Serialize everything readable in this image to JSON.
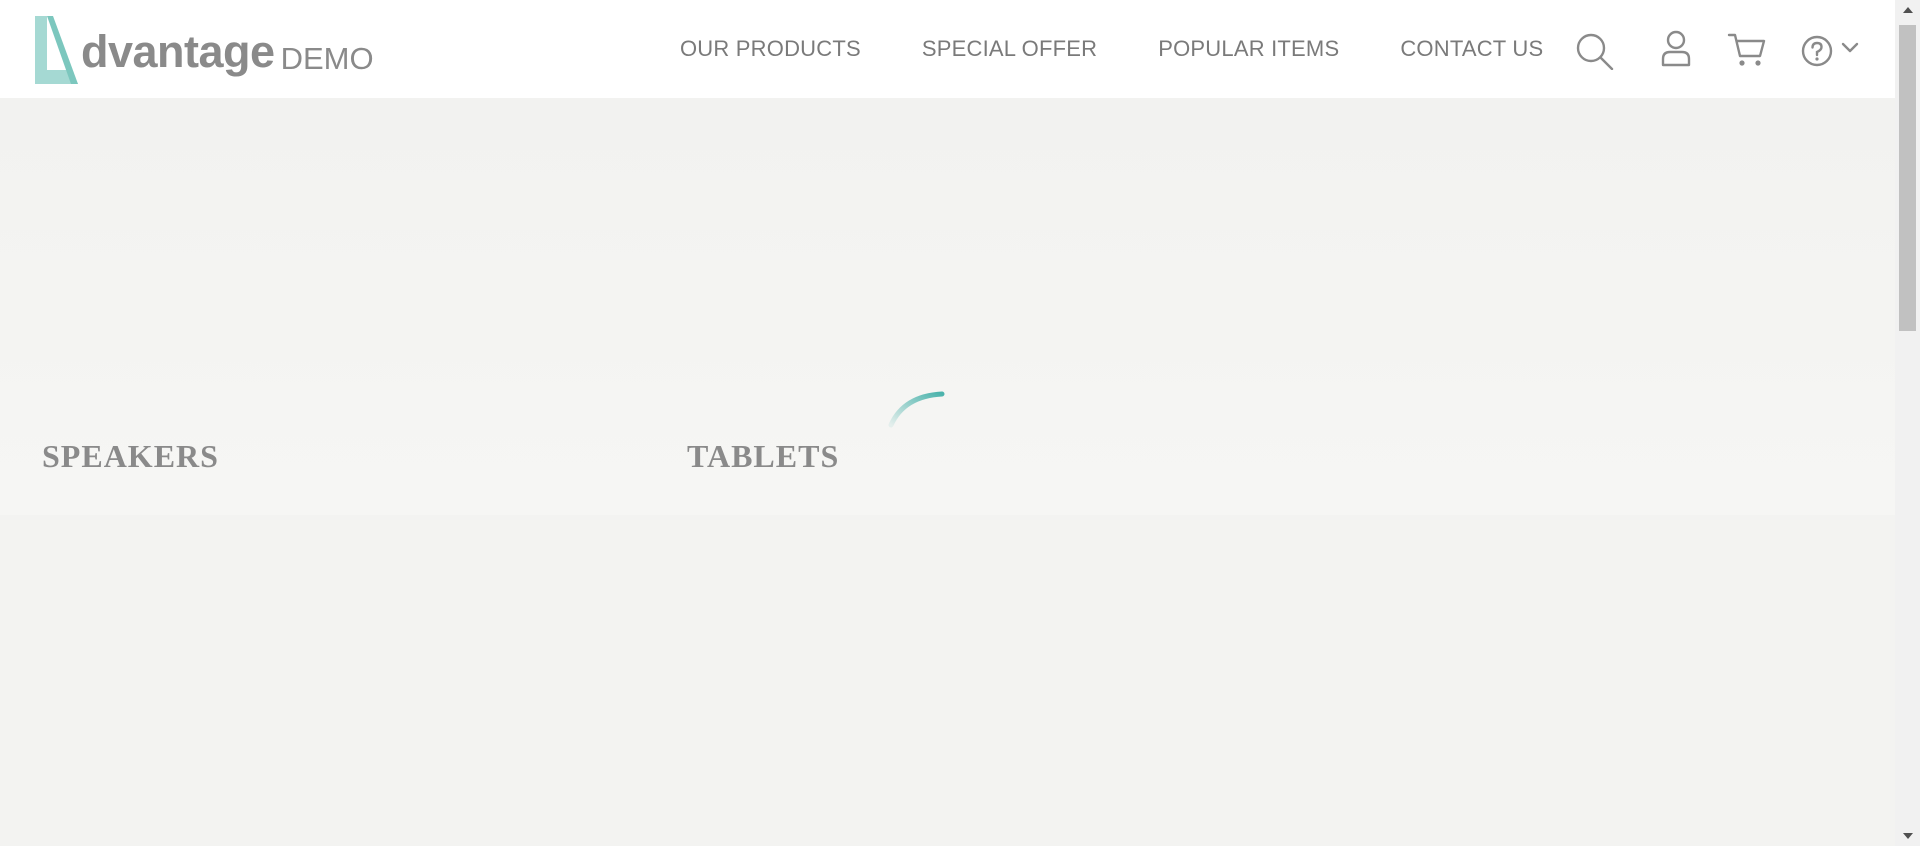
{
  "brand": {
    "name": "dvantage",
    "suffix": "DEMO",
    "accent": "#a5d9d3"
  },
  "nav": {
    "items": [
      {
        "label": "OUR PRODUCTS"
      },
      {
        "label": "SPECIAL OFFER"
      },
      {
        "label": "POPULAR ITEMS"
      },
      {
        "label": "CONTACT US"
      }
    ]
  },
  "icons": {
    "search": "search-icon",
    "user": "user-icon",
    "cart": "cart-icon",
    "help": "help-icon",
    "dropdown": "chevron-down-icon"
  },
  "categories": [
    {
      "label": "SPEAKERS"
    },
    {
      "label": "TABLETS"
    }
  ],
  "colors": {
    "text_gray": "#8a8a8a",
    "spinner": "#4bb3ac"
  }
}
